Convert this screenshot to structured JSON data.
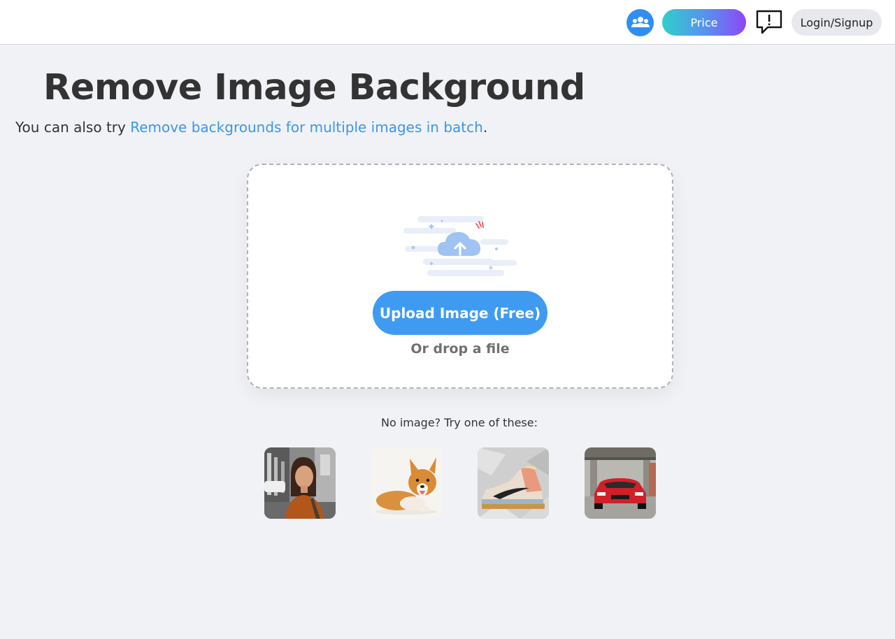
{
  "header": {
    "community_icon": "people-group-icon",
    "price_label": "Price",
    "feedback_icon": "feedback-exclamation-icon",
    "login_label": "Login/Signup"
  },
  "main": {
    "title": "Remove Image Background",
    "subtitle_prefix": "You can also try ",
    "subtitle_link": "Remove backgrounds for multiple images in batch",
    "subtitle_suffix": "."
  },
  "upload": {
    "illustration_icon": "cloud-upload-icon",
    "button_label": "Upload Image (Free)",
    "drop_hint": "Or drop a file"
  },
  "samples": {
    "label": "No image? Try one of these:",
    "items": [
      {
        "subject": "woman"
      },
      {
        "subject": "corgi-dog"
      },
      {
        "subject": "sneaker"
      },
      {
        "subject": "red-car"
      }
    ]
  },
  "colors": {
    "accent_blue": "#3f9bf2",
    "link_blue": "#3b96ee",
    "gradient_start": "#2fcfc9",
    "gradient_end": "#8f46f7",
    "page_background": "#f1f2f6"
  }
}
